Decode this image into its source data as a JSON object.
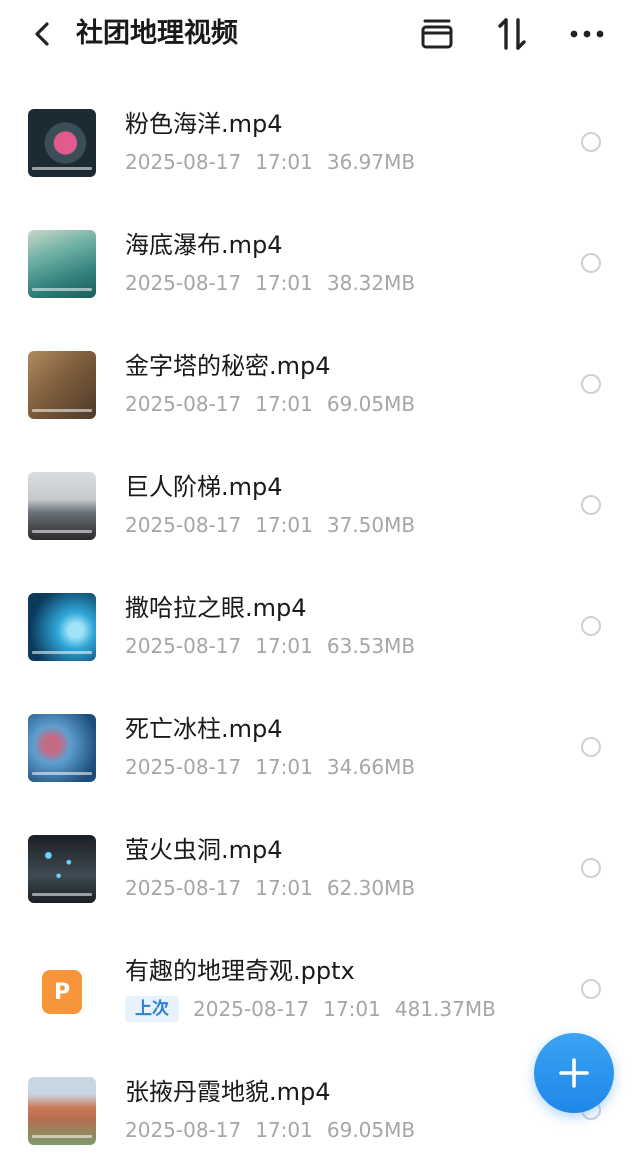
{
  "header": {
    "title": "社团地理视频",
    "icons": [
      "back-icon",
      "archive-box-icon",
      "sort-icon",
      "more-icon"
    ]
  },
  "files": [
    {
      "name": "粉色海洋.mp4",
      "date": "2025-08-17",
      "time": "17:01",
      "size": "36.97MB",
      "thumb_colors": [
        "#1b2a33",
        "#e35a8c",
        "#3a4e57"
      ]
    },
    {
      "name": "海底瀑布.mp4",
      "date": "2025-08-17",
      "time": "17:01",
      "size": "38.32MB",
      "thumb_colors": [
        "#2f7f7a",
        "#6fb0a5",
        "#c9d7c8"
      ]
    },
    {
      "name": "金字塔的秘密.mp4",
      "date": "2025-08-17",
      "time": "17:01",
      "size": "69.05MB",
      "thumb_colors": [
        "#7a5a3a",
        "#b08a5e",
        "#4b3a2a"
      ]
    },
    {
      "name": "巨人阶梯.mp4",
      "date": "2025-08-17",
      "time": "17:01",
      "size": "37.50MB",
      "thumb_colors": [
        "#d9dde0",
        "#6a7078",
        "#2a2a2a"
      ]
    },
    {
      "name": "撒哈拉之眼.mp4",
      "date": "2025-08-17",
      "time": "17:01",
      "size": "63.53MB",
      "thumb_colors": [
        "#0b3a5c",
        "#2fa7d8",
        "#9fe3f7"
      ]
    },
    {
      "name": "死亡冰柱.mp4",
      "date": "2025-08-17",
      "time": "17:01",
      "size": "34.66MB",
      "thumb_colors": [
        "#1e4d7a",
        "#5e9fd0",
        "#c56a85"
      ]
    },
    {
      "name": "萤火虫洞.mp4",
      "date": "2025-08-17",
      "time": "17:01",
      "size": "62.30MB",
      "thumb_colors": [
        "#1a1f24",
        "#3f4a52",
        "#6fd3ff"
      ]
    },
    {
      "name": "有趣的地理奇观.pptx",
      "badge": "上次",
      "date": "2025-08-17",
      "time": "17:01",
      "size": "481.37MB",
      "file_icon_letter": "P",
      "file_icon_color": "#f7953a"
    },
    {
      "name": "张掖丹霞地貌.mp4",
      "date": "2025-08-17",
      "time": "17:01",
      "size": "69.05MB",
      "thumb_colors": [
        "#c9d6e3",
        "#c97a5a",
        "#7a9a6a"
      ]
    }
  ],
  "fab": {
    "icon": "plus-icon",
    "color": "#2a8fea"
  }
}
